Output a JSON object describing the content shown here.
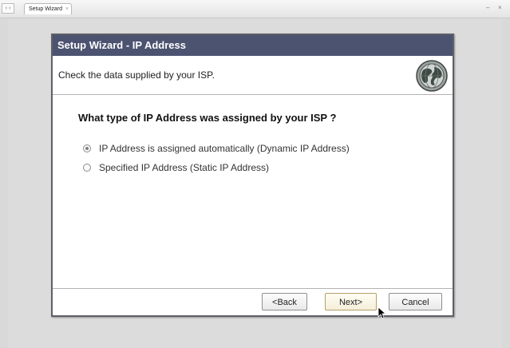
{
  "tabstrip": {
    "tab_label": "Setup Wizard",
    "tab_close": "×",
    "nav_glyph": "‹ ›",
    "min_glyph": "–",
    "close_glyph": "×"
  },
  "dialog": {
    "title": "Setup Wizard - IP Address",
    "header_text": "Check the data supplied by your ISP.",
    "question": "What type of IP Address was assigned by your ISP ?",
    "options": [
      {
        "label": "IP Address is assigned automatically (Dynamic IP Address)",
        "selected": true
      },
      {
        "label": "Specified IP Address (Static IP Address)",
        "selected": false
      }
    ],
    "buttons": {
      "back": "<Back",
      "next": "Next>",
      "cancel": "Cancel"
    }
  },
  "colors": {
    "titlebar": "#4c5371",
    "background": "#d9d9d9",
    "next_button_tint": "#f5efd9"
  }
}
